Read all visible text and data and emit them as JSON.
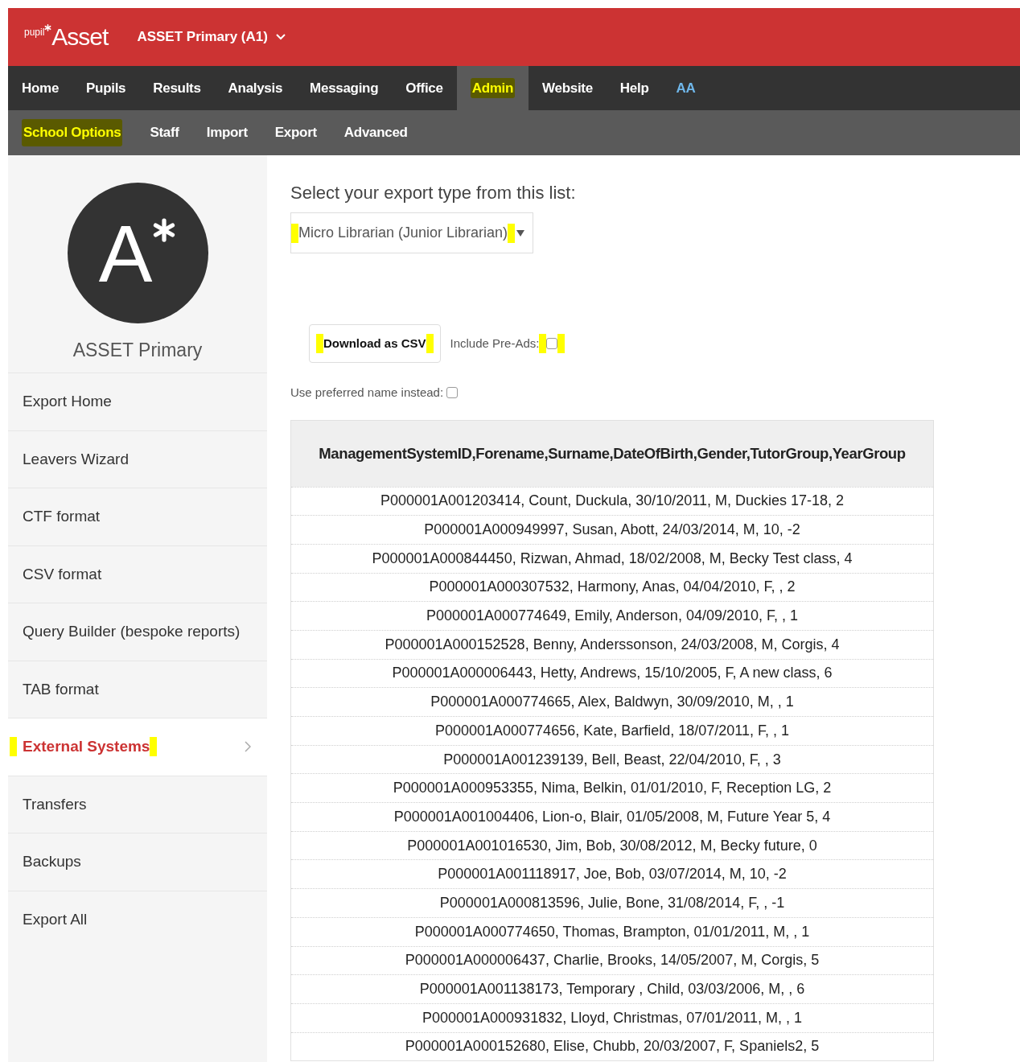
{
  "header": {
    "logo_small": "pupil",
    "logo": "Asset",
    "school": "ASSET Primary (A1)"
  },
  "nav": [
    {
      "label": "Home",
      "kind": "menu",
      "selected": false
    },
    {
      "label": "Pupils",
      "kind": "menu",
      "selected": false
    },
    {
      "label": "Results",
      "kind": "menu",
      "selected": false
    },
    {
      "label": "Analysis",
      "kind": "menu",
      "selected": false
    },
    {
      "label": "Messaging",
      "kind": "menu",
      "selected": false
    },
    {
      "label": "Office",
      "kind": "menu",
      "selected": false
    },
    {
      "label": "Admin",
      "kind": "menu",
      "selected": true
    },
    {
      "label": "Website",
      "kind": "menu",
      "selected": false
    },
    {
      "label": "Help",
      "kind": "menu",
      "selected": false
    },
    {
      "label": "AA",
      "kind": "text-size",
      "selected": false
    }
  ],
  "subnav": [
    {
      "label": "School Options",
      "selected": true
    },
    {
      "label": "Staff",
      "selected": false
    },
    {
      "label": "Import",
      "selected": false
    },
    {
      "label": "Export",
      "selected": false
    },
    {
      "label": "Advanced",
      "selected": false
    }
  ],
  "sidebar": {
    "avatar_letter": "A",
    "school_name": "ASSET Primary",
    "items": [
      {
        "label": "Export Home",
        "selected": false
      },
      {
        "label": "Leavers Wizard",
        "selected": false
      },
      {
        "label": "CTF format",
        "selected": false
      },
      {
        "label": "CSV format",
        "selected": false
      },
      {
        "label": "Query Builder (bespoke reports)",
        "selected": false
      },
      {
        "label": "TAB format",
        "selected": false
      },
      {
        "label": "External Systems",
        "selected": true
      },
      {
        "label": "Transfers",
        "selected": false
      },
      {
        "label": "Backups",
        "selected": false
      },
      {
        "label": "Export All",
        "selected": false
      }
    ]
  },
  "export": {
    "prompt": "Select your export type from this list:",
    "select_value": "Micro Librarian (Junior Librarian)",
    "download_button": "Download as CSV",
    "include_preads": {
      "label": "Include Pre-Ads:",
      "checked": false
    },
    "preferred_name": {
      "label": "Use preferred name instead:",
      "checked": false
    }
  },
  "table": {
    "header": "ManagementSystemID,Forename,Surname,DateOfBirth,Gender,TutorGroup,YearGroup",
    "rows": [
      "P000001A001203414, Count, Duckula, 30/10/2011, M, Duckies 17-18, 2",
      "P000001A000949997, Susan, Abott, 24/03/2014, M, 10, -2",
      "P000001A000844450, Rizwan, Ahmad, 18/02/2008, M, Becky Test class, 4",
      "P000001A000307532, Harmony, Anas, 04/04/2010, F, , 2",
      "P000001A000774649, Emily, Anderson, 04/09/2010, F, , 1",
      "P000001A000152528, Benny, Anderssonson, 24/03/2008, M, Corgis, 4",
      "P000001A000006443, Hetty, Andrews, 15/10/2005, F, A new class, 6",
      "P000001A000774665, Alex, Baldwyn, 30/09/2010, M, , 1",
      "P000001A000774656, Kate, Barfield, 18/07/2011, F, , 1",
      "P000001A001239139, Bell, Beast, 22/04/2010, F, , 3",
      "P000001A000953355, Nima, Belkin, 01/01/2010, F, Reception LG, 2",
      "P000001A001004406, Lion-o, Blair, 01/05/2008, M, Future Year 5, 4",
      "P000001A001016530, Jim, Bob, 30/08/2012, M, Becky future, 0",
      "P000001A001118917, Joe, Bob, 03/07/2014, M, 10, -2",
      "P000001A000813596, Julie, Bone, 31/08/2014, F, , -1",
      "P000001A000774650, Thomas, Brampton, 01/01/2011, M, , 1",
      "P000001A000006437, Charlie, Brooks, 14/05/2007, M, Corgis, 5",
      "P000001A001138173, Temporary , Child, 03/03/2006, M, , 6",
      "P000001A000931832, Lloyd, Christmas, 07/01/2011, M, , 1",
      "P000001A000152680, Elise, Chubb, 20/03/2007, F, Spaniels2, 5"
    ]
  }
}
